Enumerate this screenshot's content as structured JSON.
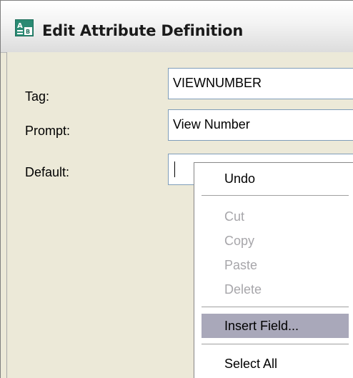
{
  "dialog": {
    "title": "Edit Attribute Definition",
    "icon": "attribute-definition-icon"
  },
  "fields": {
    "tag_label": "Tag:",
    "tag_value": "VIEWNUMBER",
    "prompt_label": "Prompt:",
    "prompt_value": "View Number",
    "default_label": "Default:",
    "default_value": ""
  },
  "context_menu": {
    "undo": "Undo",
    "cut": "Cut",
    "copy": "Copy",
    "paste": "Paste",
    "delete": "Delete",
    "insert_field": "Insert Field...",
    "select_all": "Select All"
  },
  "colors": {
    "highlight": "#a9a8ba",
    "disabled_text": "#a7a6aa"
  }
}
